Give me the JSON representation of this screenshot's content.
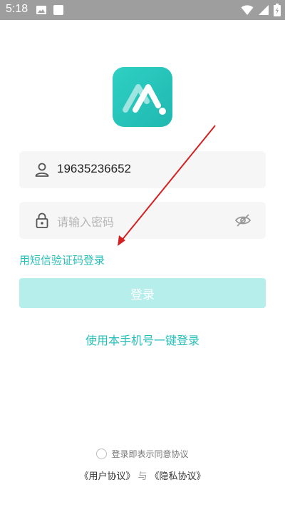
{
  "status_bar": {
    "time": "5:18"
  },
  "login": {
    "phone_value": "19635236652",
    "password_placeholder": "请输入密码",
    "sms_login_link": "用短信验证码登录",
    "login_button": "登录",
    "one_key_login": "使用本手机号一键登录",
    "agreement_text": "登录即表示同意协议",
    "user_agreement": "《用户协议》",
    "and_text": "与",
    "privacy_policy": "《隐私协议》"
  },
  "colors": {
    "accent": "#26bfb7",
    "button_disabled": "#b5eeeb",
    "status_bar": "#9e9e9e",
    "annotation_arrow": "#d32020"
  }
}
